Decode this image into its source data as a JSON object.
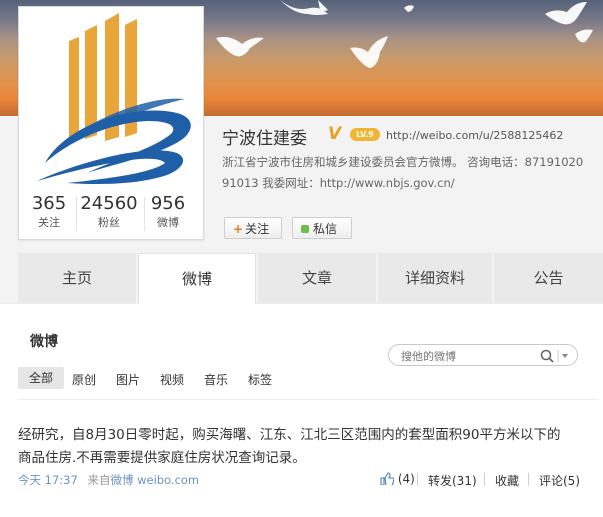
{
  "profile": {
    "name": "宁波住建委",
    "verified_badge": "V",
    "level": "LV.9",
    "url": "http://weibo.com/u/2588125462",
    "description_line1": "浙江省宁波市住房和城乡建设委员会官方微博。 咨询电话：87191020",
    "description_line2": "91013 我委网址：http://www.nbjs.gov.cn/",
    "stats": [
      {
        "num": "365",
        "label": "关注"
      },
      {
        "num": "24560",
        "label": "粉丝"
      },
      {
        "num": "956",
        "label": "微博"
      }
    ],
    "follow_label": "关注",
    "message_label": "私信"
  },
  "tabs": [
    "主页",
    "微博",
    "文章",
    "详细资料",
    "公告"
  ],
  "active_tab": "微博",
  "feed": {
    "title": "微博",
    "search_placeholder": "搜他的微博",
    "filters": [
      "全部",
      "原创",
      "图片",
      "视频",
      "音乐",
      "标签"
    ],
    "post": {
      "text_line1": "经研究，自8月30日零时起，购买海曙、江东、江北三区范围内的套型面积90平方米以下的",
      "text_line2": "商品住房.不再需要提供家庭住房状况查询记录。",
      "time": "今天 17:37",
      "source_prefix": "来自",
      "source": "微博 weibo.com",
      "like": "(4)",
      "repost": "转发(31)",
      "favorite": "收藏",
      "comment": "评论(5)"
    }
  },
  "colors": {
    "accent_orange": "#e8a020",
    "link_blue": "#6a95c2",
    "logo_blue": "#1f5fa8",
    "logo_gold": "#e9a43a"
  }
}
